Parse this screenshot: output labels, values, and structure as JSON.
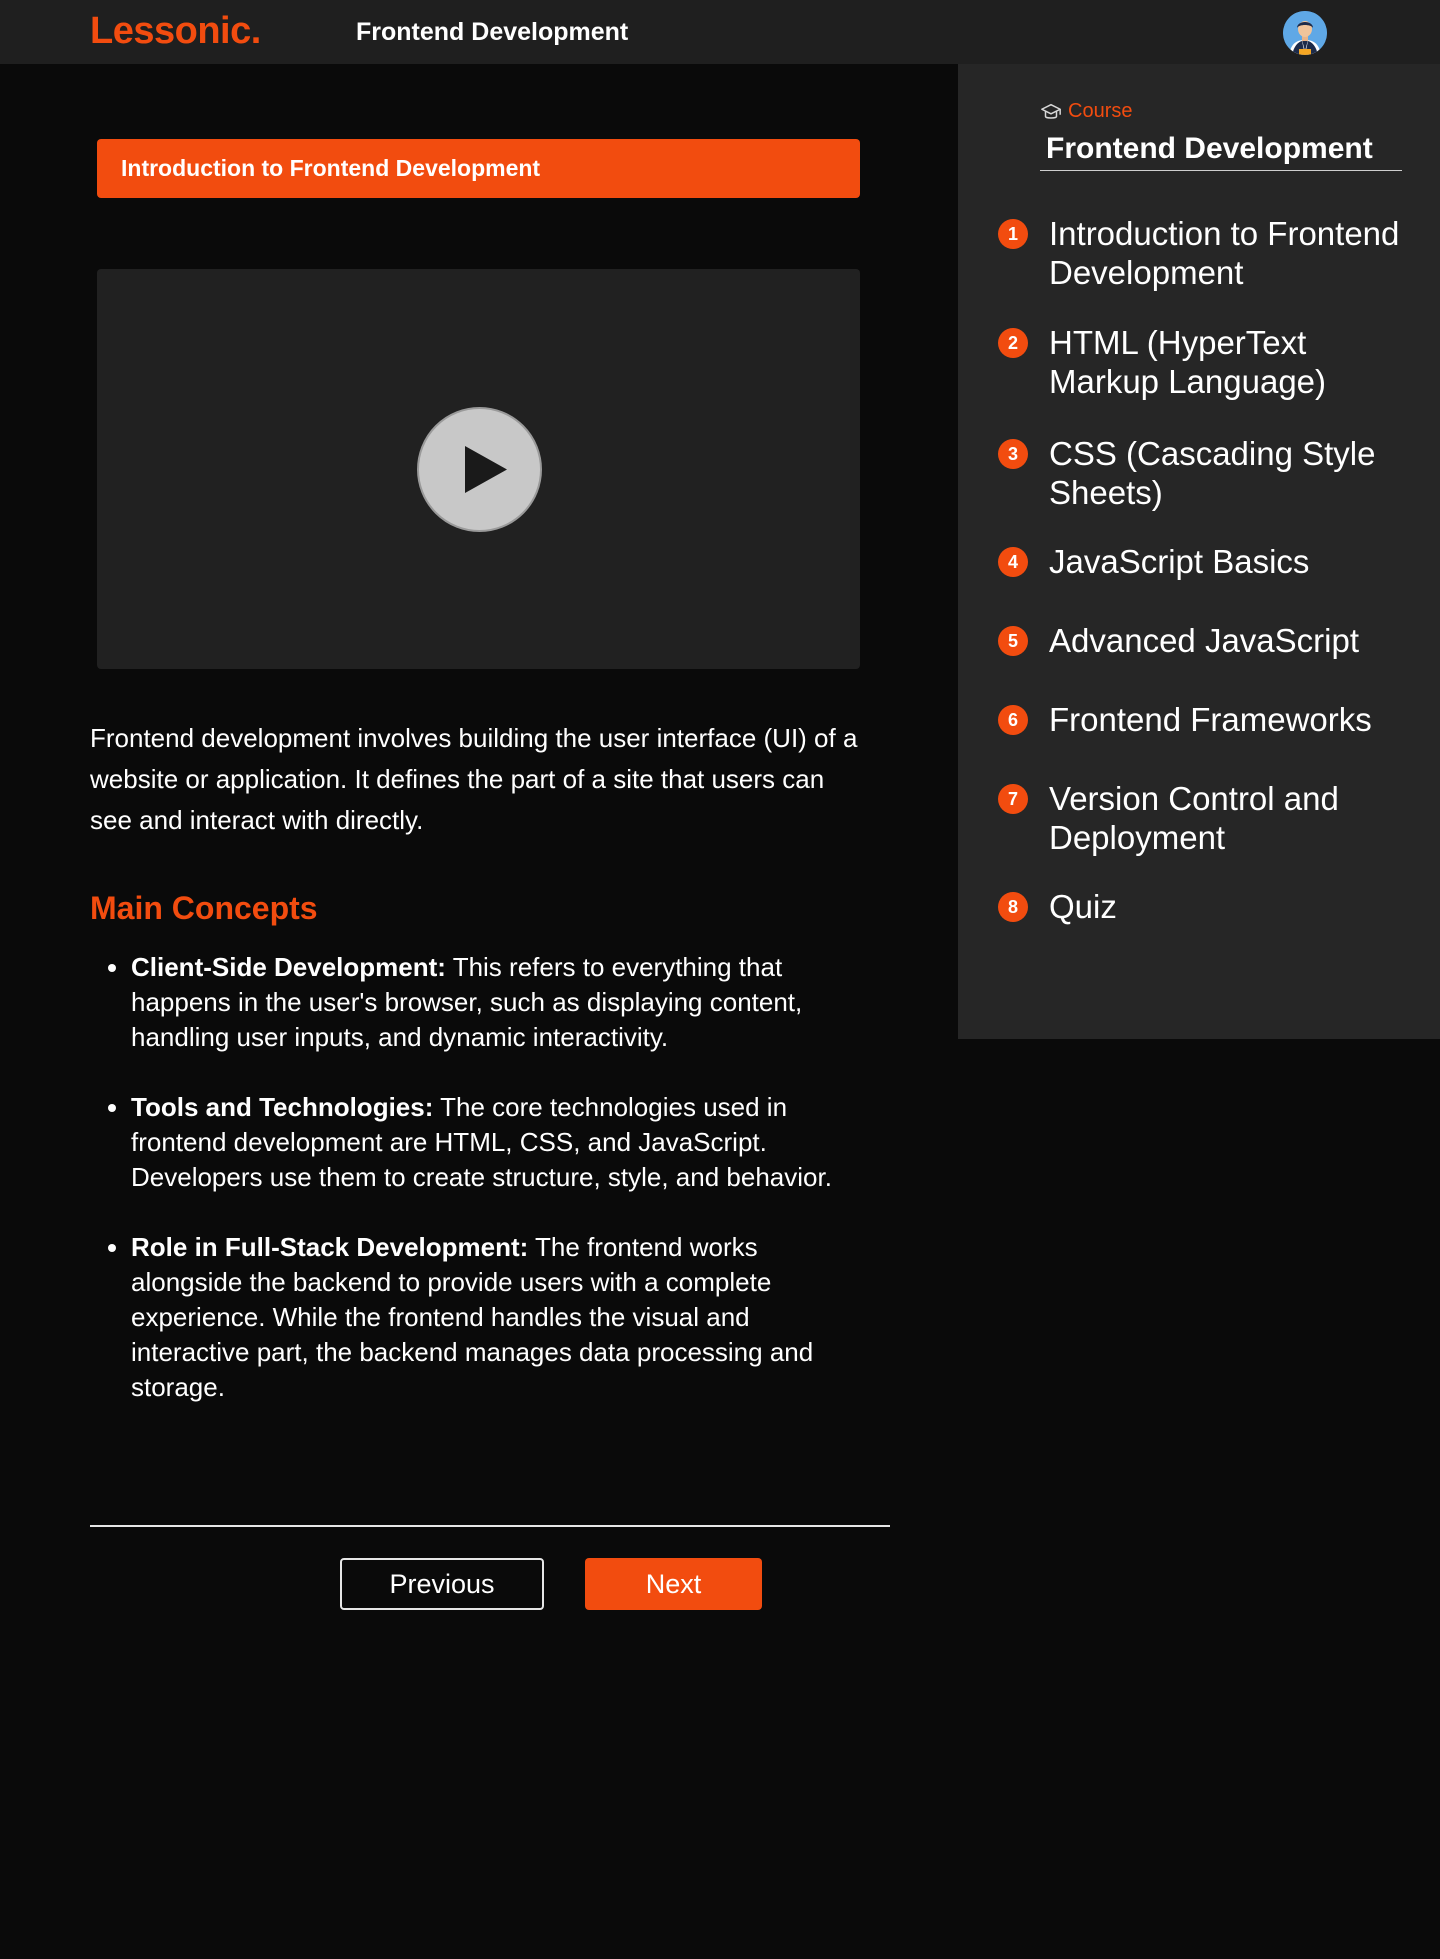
{
  "header": {
    "logo": "Lessonic.",
    "title": "Frontend Development",
    "avatar_icon": "user-avatar-icon"
  },
  "colors": {
    "accent": "#f24c0f",
    "background": "#0a0a0a",
    "topbar": "#1f1f1f",
    "sidebar": "#262626",
    "video": "#212121"
  },
  "lesson": {
    "title": "Introduction to Frontend Development",
    "video_icon": "play-icon",
    "intro": "Frontend development involves building the user interface (UI) of a website or application. It defines the part of a site that users can see and interact with directly.",
    "section_heading": "Main Concepts",
    "concepts": [
      {
        "term": "Client-Side Development:",
        "text": " This refers to everything that happens in the user's browser, such as displaying content, handling user inputs, and dynamic interactivity."
      },
      {
        "term": "Tools and Technologies:",
        "text": " The core technologies used in frontend development are HTML, CSS, and JavaScript. Developers use them to create structure, style, and behavior."
      },
      {
        "term": "Role in Full-Stack Development:",
        "text": " The frontend works alongside the backend to provide users with a complete experience. While the frontend handles the visual and interactive part, the backend manages data processing and storage."
      }
    ]
  },
  "nav": {
    "previous_label": "Previous",
    "next_label": "Next"
  },
  "sidebar": {
    "tag_icon": "graduation-cap-icon",
    "tag": "Course",
    "course_title": "Frontend Development",
    "items": [
      {
        "number": "1",
        "label": "Introduction to Frontend Development"
      },
      {
        "number": "2",
        "label": "HTML (HyperText Markup Language)"
      },
      {
        "number": "3",
        "label": "CSS (Cascading Style Sheets)"
      },
      {
        "number": "4",
        "label": "JavaScript Basics"
      },
      {
        "number": "5",
        "label": "Advanced JavaScript"
      },
      {
        "number": "6",
        "label": "Frontend Frameworks"
      },
      {
        "number": "7",
        "label": "Version Control and  Deployment"
      },
      {
        "number": "8",
        "label": "Quiz"
      }
    ]
  }
}
